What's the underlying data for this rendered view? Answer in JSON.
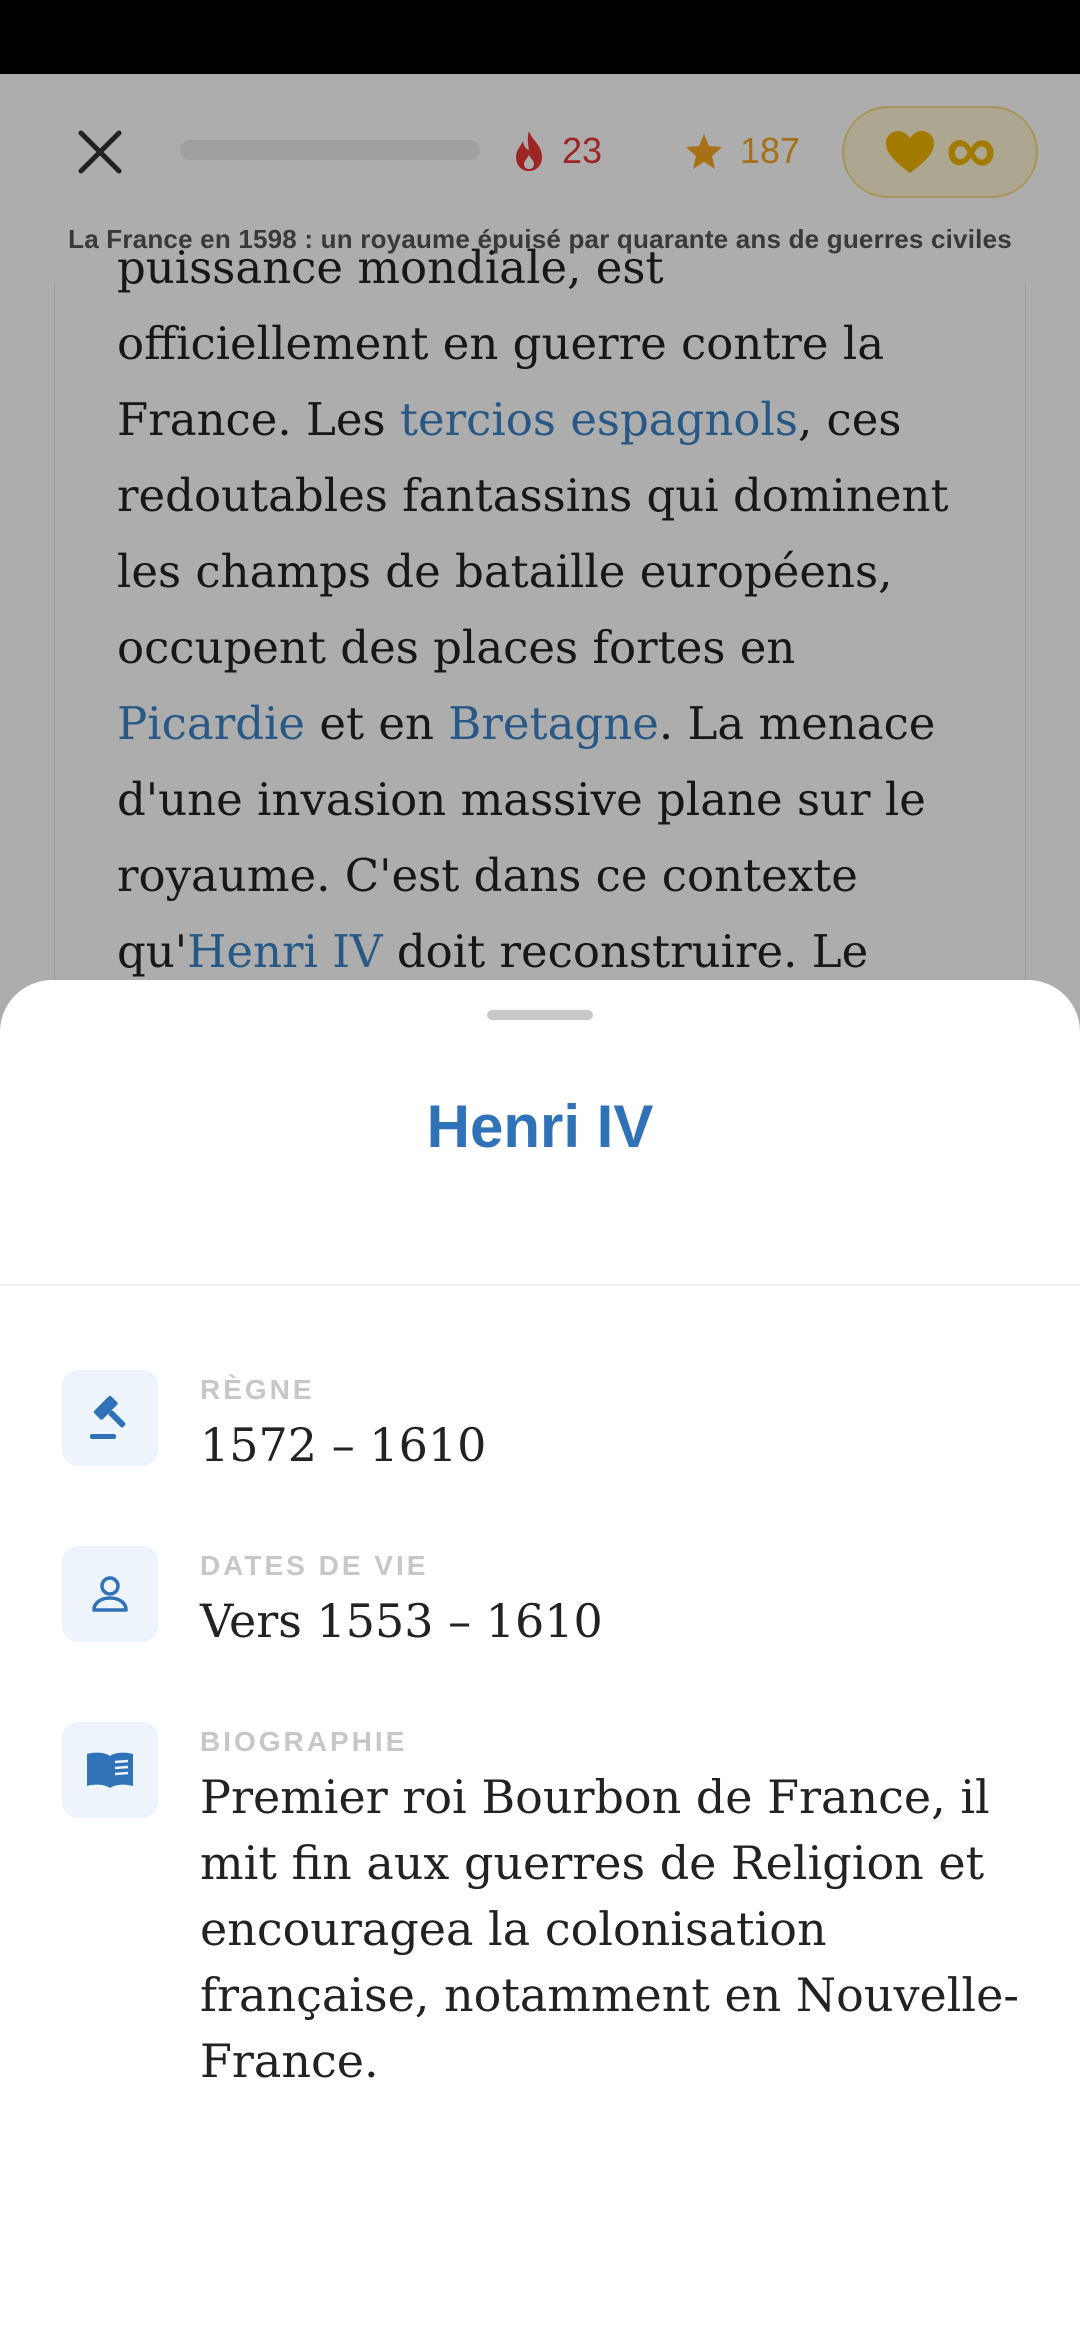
{
  "header": {
    "streak_count": "23",
    "stars_count": "187",
    "lives_symbol": "∞",
    "lesson_title": "La France en 1598 : un royaume épuisé par quarante ans de guerres civiles"
  },
  "article": {
    "line1": "puissance mondiale, est",
    "line2": "officiellement en guerre contre la",
    "line3_a": "France. Les ",
    "line3_link": "tercios espagnols",
    "line3_b": ", ces",
    "line4": "redoutables fantassins qui dominent",
    "line5": "les champs de bataille européens,",
    "line6": "occupent des places fortes en",
    "line7_link1": "Picardie",
    "line7_mid": " et en ",
    "line7_link2": "Bretagne",
    "line7_b": ". La menace",
    "line8": "d'une invasion massive plane sur le",
    "line9": "royaume. C'est dans ce contexte",
    "line10_a": "qu'",
    "line10_link": "Henri IV",
    "line10_b": " doit reconstruire. Le"
  },
  "sheet": {
    "title": "Henri IV",
    "rows": [
      {
        "icon": "gavel-icon",
        "label": "RÈGNE",
        "value": "1572 – 1610"
      },
      {
        "icon": "person-icon",
        "label": "DATES DE VIE",
        "value": "Vers 1553 – 1610"
      },
      {
        "icon": "book-icon",
        "label": "BIOGRAPHIE",
        "value": "Premier roi Bourbon de France, il mit fin aux guerres de Religion et encouragea la colonisation française, notamment en Nouvelle-France."
      }
    ]
  },
  "colors": {
    "accent": "#2f72b8",
    "link": "#3b82c4",
    "streak": "#e53935",
    "star": "#f5a623",
    "heart": "#f0b400"
  }
}
